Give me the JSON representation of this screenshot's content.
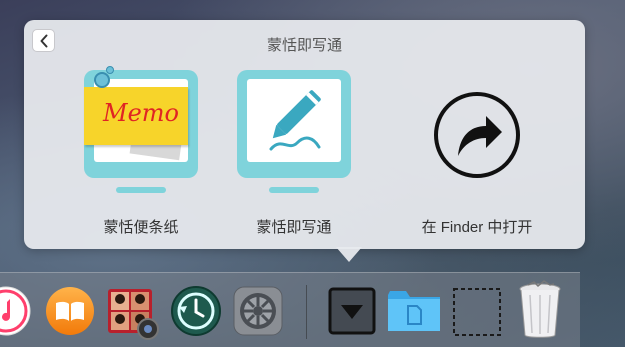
{
  "popover": {
    "title": "蒙恬即写通",
    "items": [
      {
        "label": "蒙恬便条纸",
        "icon": "memo-app-icon",
        "memo_text": "Memo"
      },
      {
        "label": "蒙恬即写通",
        "icon": "pen-app-icon"
      },
      {
        "label": "在 Finder 中打开",
        "icon": "open-in-finder-arrow-icon"
      }
    ]
  },
  "dock": {
    "items": [
      {
        "name": "itunes-icon"
      },
      {
        "name": "ibooks-icon"
      },
      {
        "name": "photo-booth-icon"
      },
      {
        "name": "time-machine-icon"
      },
      {
        "name": "system-preferences-icon"
      },
      {
        "name": "downloads-stack-icon"
      },
      {
        "name": "documents-folder-icon"
      },
      {
        "name": "empty-stack-icon"
      },
      {
        "name": "trash-icon"
      }
    ]
  },
  "colors": {
    "accent": "#7fd3db",
    "memo_yellow": "#f7d42a",
    "memo_text": "#e02424",
    "pen_blue": "#3aa8c0"
  }
}
